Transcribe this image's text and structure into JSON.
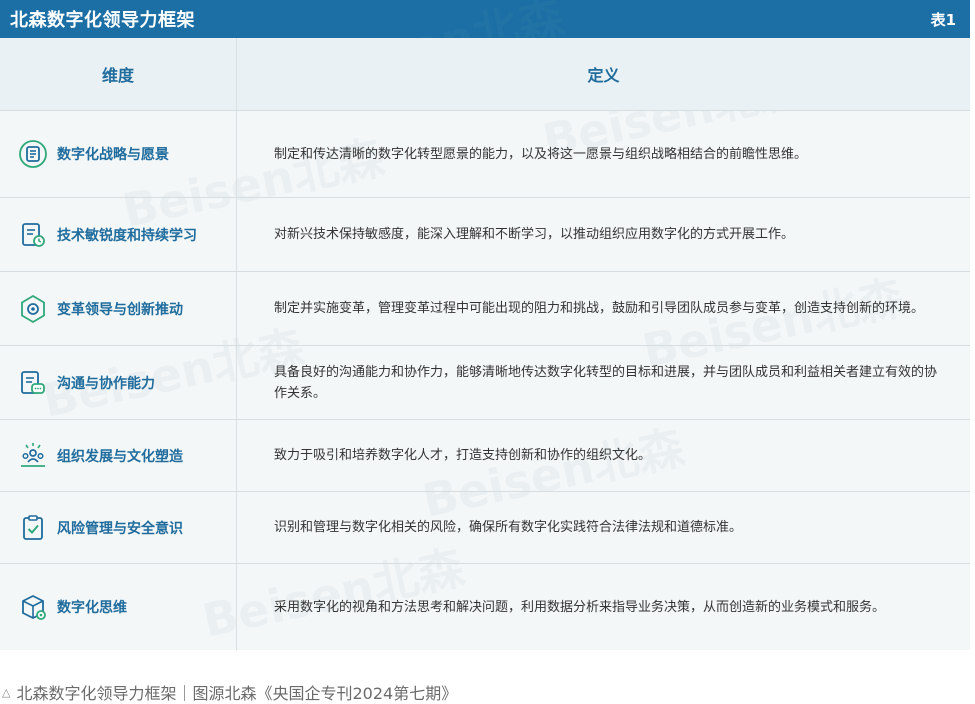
{
  "header": {
    "title": "北森数字化领导力框架",
    "tag": "表1"
  },
  "table": {
    "columns": [
      "维度",
      "定义"
    ],
    "rows": [
      {
        "icon": "strategy-icon",
        "dimension": "数字化战略与愿景",
        "definition": "制定和传达清晰的数字化转型愿景的能力，以及将这一愿景与组织战略相结合的前瞻性思维。"
      },
      {
        "icon": "learning-icon",
        "dimension": "技术敏锐度和持续学习",
        "definition": "对新兴技术保持敏感度，能深入理解和不断学习，以推动组织应用数字化的方式开展工作。"
      },
      {
        "icon": "change-icon",
        "dimension": "变革领导与创新推动",
        "definition": "制定并实施变革，管理变革过程中可能出现的阻力和挑战，鼓励和引导团队成员参与变革，创造支持创新的环境。"
      },
      {
        "icon": "communication-icon",
        "dimension": "沟通与协作能力",
        "definition": "具备良好的沟通能力和协作力，能够清晰地传达数字化转型的目标和进展，并与团队成员和利益相关者建立有效的协作关系。"
      },
      {
        "icon": "team-icon",
        "dimension": "组织发展与文化塑造",
        "definition": "致力于吸引和培养数字化人才，打造支持创新和协作的组织文化。"
      },
      {
        "icon": "risk-icon",
        "dimension": "风险管理与安全意识",
        "definition": "识别和管理与数字化相关的风险，确保所有数字化实践符合法律法规和道德标准。"
      },
      {
        "icon": "cube-icon",
        "dimension": "数字化思维",
        "definition": "采用数字化的视角和方法思考和解决问题，利用数据分析来指导业务决策，从而创造新的业务模式和服务。"
      }
    ]
  },
  "watermark": "Beisen北森",
  "caption": "北森数字化领导力框架｜图源北森《央国企专刊2024第七期》",
  "colors": {
    "header_bg": "#1b6fa5",
    "accent": "#1f6c9d",
    "icon_green": "#2fa87a"
  }
}
